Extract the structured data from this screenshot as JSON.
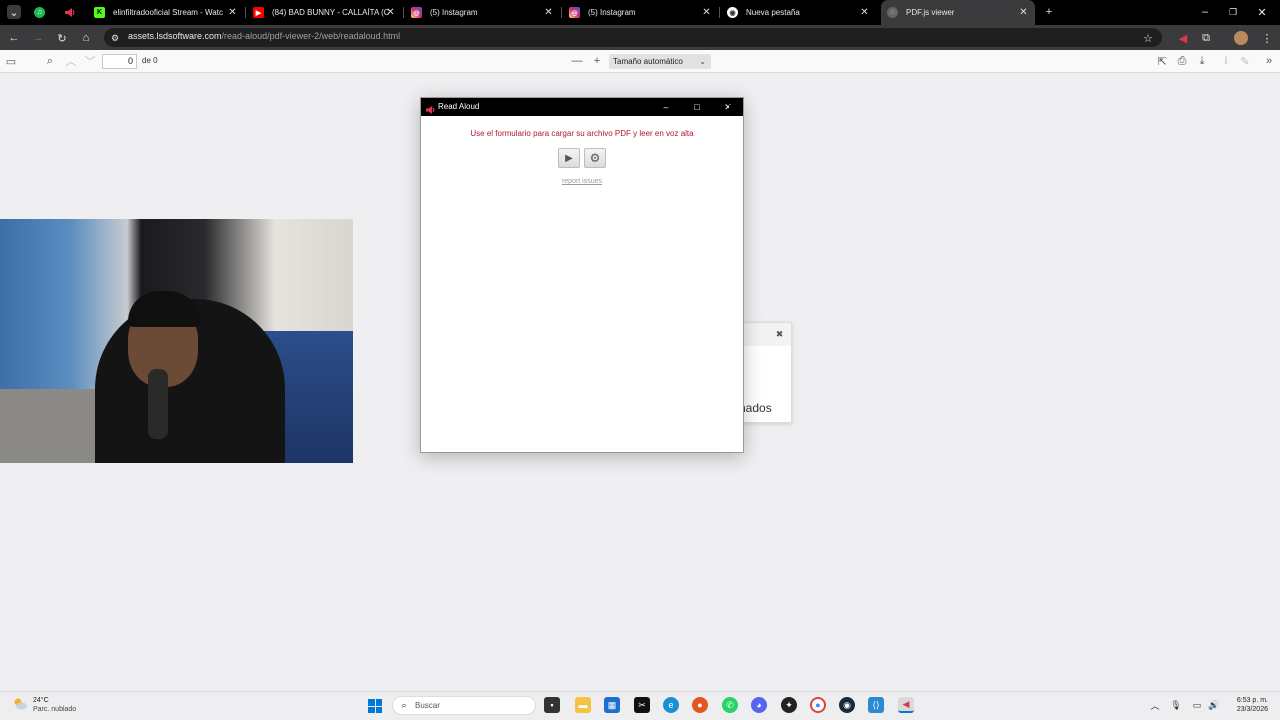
{
  "browser": {
    "tabs": [
      {
        "label": "",
        "icon": "spotify-icon",
        "color": "#1db954"
      },
      {
        "label": "",
        "icon": "read-aloud-icon",
        "color": "#e0364d"
      },
      {
        "label": "elinfiltradooficial Stream - Watc",
        "icon": "kick-icon",
        "color": "#53fc18"
      },
      {
        "label": "(84) BAD BUNNY - CALLAÍTA (C",
        "icon": "youtube-icon",
        "color": "#ff0000"
      },
      {
        "label": "(5) Instagram",
        "icon": "instagram-icon",
        "color": "#d62976"
      },
      {
        "label": "(5) Instagram",
        "icon": "instagram-icon",
        "color": "#d62976"
      },
      {
        "label": "Nueva pestaña",
        "icon": "chrome-icon",
        "color": "#ffffff"
      },
      {
        "label": "PDF.js viewer",
        "icon": "pdfjs-icon",
        "color": "#888888",
        "active": true
      }
    ],
    "url_host": "assets.lsdsoftware.com",
    "url_path": "/read-aloud/pdf-viewer-2/web/readaloud.html"
  },
  "pdfjs": {
    "page_number": "0",
    "page_of": "de 0",
    "zoom": "Tamaño automático"
  },
  "popup": {
    "title": "Read Aloud",
    "message": "Use el formulario para cargar su archivo PDF y leer en voz alta",
    "report_link": "report issues"
  },
  "background_dialog": {
    "text": "nados"
  },
  "taskbar": {
    "temperature": "24°C",
    "condition": "Parc. nublado",
    "search_placeholder": "Buscar",
    "time": "6:53 p. m.",
    "date": "23/3/2026"
  },
  "colors": {
    "accent_red": "#b0182e",
    "windows_blue": "#0078d4"
  }
}
